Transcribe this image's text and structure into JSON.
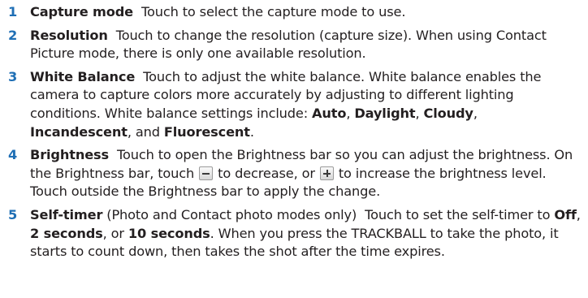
{
  "items": [
    {
      "num": "1",
      "term": "Capture mode",
      "text": "  Touch to select the capture mode to use."
    },
    {
      "num": "2",
      "term": "Resolution",
      "text": "  Touch to change the resolution (capture size). When using Contact Picture mode, there is only one available resolution."
    },
    {
      "num": "3",
      "term": "White Balance",
      "text": "  Touch to adjust the white balance. White balance enables the camera to capture colors more accurately by adjusting to different lighting conditions. White balance settings include: ",
      "options": [
        "Auto",
        "Daylight",
        "Cloudy",
        "Incandescent",
        "Fluorescent"
      ],
      "sep1": ", ",
      "sep2": ", ",
      "sep3": ",",
      "sep4": ", and ",
      "end": "."
    },
    {
      "num": "4",
      "term": "Brightness",
      "text_a": "  Touch to open the Brightness bar so you can adjust the brightness. On the Brightness bar, touch ",
      "text_b": " to decrease, or ",
      "text_c": " to increase the brightness level. Touch outside the Brightness bar to apply the change.",
      "minus_icon": "minus-icon",
      "plus_icon": "plus-icon"
    },
    {
      "num": "5",
      "term": "Self-timer",
      "text_a": " (Photo and Contact photo modes only)  Touch to set the self-timer to ",
      "options": [
        "Off",
        "2 seconds",
        "10 seconds"
      ],
      "sep1": ", ",
      "sep2": ", or ",
      "text_b": ". When you press the TRACKBALL to take the photo, it starts to count down, then takes the shot after the time expires."
    }
  ],
  "colors": {
    "number": "#1f6fb5",
    "text": "#231f20"
  }
}
